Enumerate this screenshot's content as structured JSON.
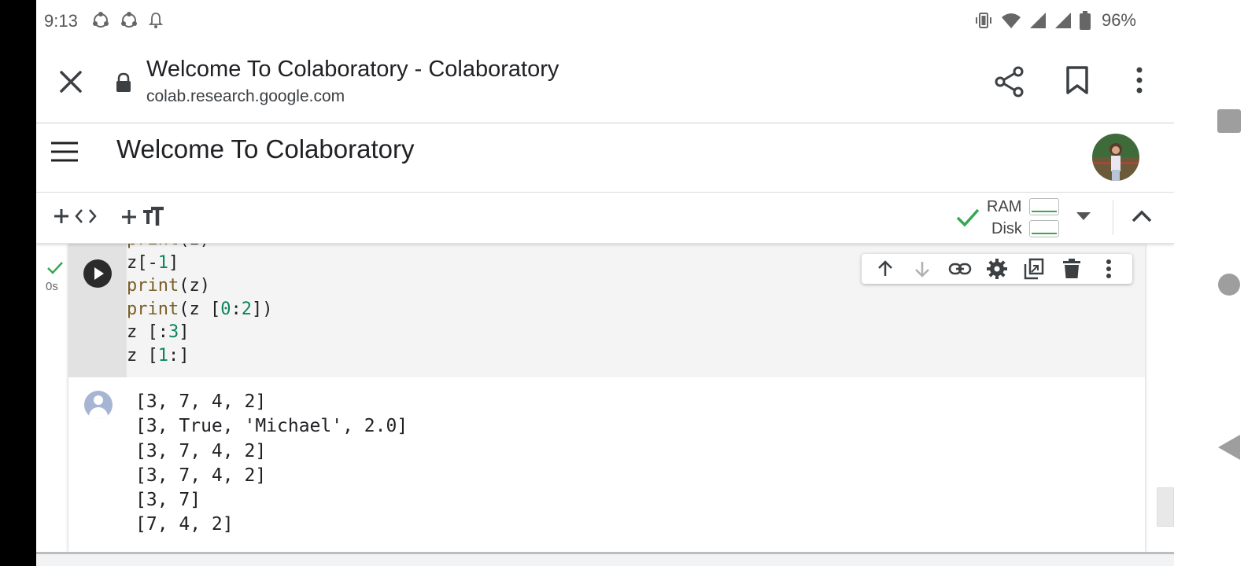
{
  "status_bar": {
    "time": "9:13",
    "battery_percent": "96%"
  },
  "browser": {
    "page_title": "Welcome To Colaboratory - Colaboratory",
    "domain": "colab.research.google.com"
  },
  "notebook": {
    "title": "Welcome To Colaboratory"
  },
  "toolbar": {
    "ram_label": "RAM",
    "disk_label": "Disk"
  },
  "cell": {
    "exec_time": "0s",
    "code_lines": [
      [
        {
          "t": "print",
          "c": "fn"
        },
        {
          "t": "(z)",
          "c": ""
        }
      ],
      [
        {
          "t": "z[-",
          "c": ""
        },
        {
          "t": "1",
          "c": "num"
        },
        {
          "t": "]",
          "c": ""
        }
      ],
      [
        {
          "t": "print",
          "c": "fn"
        },
        {
          "t": "(z)",
          "c": ""
        }
      ],
      [
        {
          "t": "print",
          "c": "fn"
        },
        {
          "t": "(z [",
          "c": ""
        },
        {
          "t": "0",
          "c": "num"
        },
        {
          "t": ":",
          "c": ""
        },
        {
          "t": "2",
          "c": "num"
        },
        {
          "t": "])",
          "c": ""
        }
      ],
      [
        {
          "t": "z [:",
          "c": ""
        },
        {
          "t": "3",
          "c": "num"
        },
        {
          "t": "]",
          "c": ""
        }
      ],
      [
        {
          "t": "z [",
          "c": ""
        },
        {
          "t": "1",
          "c": "num"
        },
        {
          "t": ":]",
          "c": ""
        }
      ]
    ],
    "output_lines": [
      "[3, 7, 4, 2]",
      "[3, True, 'Michael', 2.0]",
      "[3, 7, 4, 2]",
      "[3, 7, 4, 2]",
      "[3, 7]",
      "[7, 4, 2]"
    ]
  },
  "colors": {
    "accent_green": "#34a853",
    "code_function": "#795e26",
    "code_number": "#098658"
  }
}
